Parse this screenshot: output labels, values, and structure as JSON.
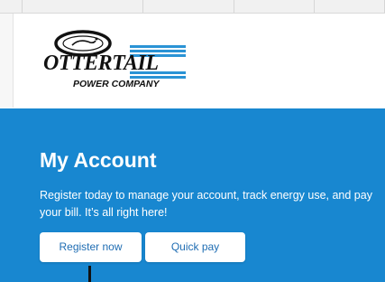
{
  "colors": {
    "brand_blue": "#1887d0",
    "logo_stripes": "#2a93d5",
    "button_text": "#1f6db3"
  },
  "logo": {
    "wordmark": "OTTERTAIL",
    "subtitle": "POWER COMPANY"
  },
  "hero": {
    "title": "My Account",
    "description": "Register today to manage your account, track energy use, and pay your bill. It’s all right here!",
    "buttons": {
      "register_label": "Register now",
      "quickpay_label": "Quick pay"
    }
  }
}
